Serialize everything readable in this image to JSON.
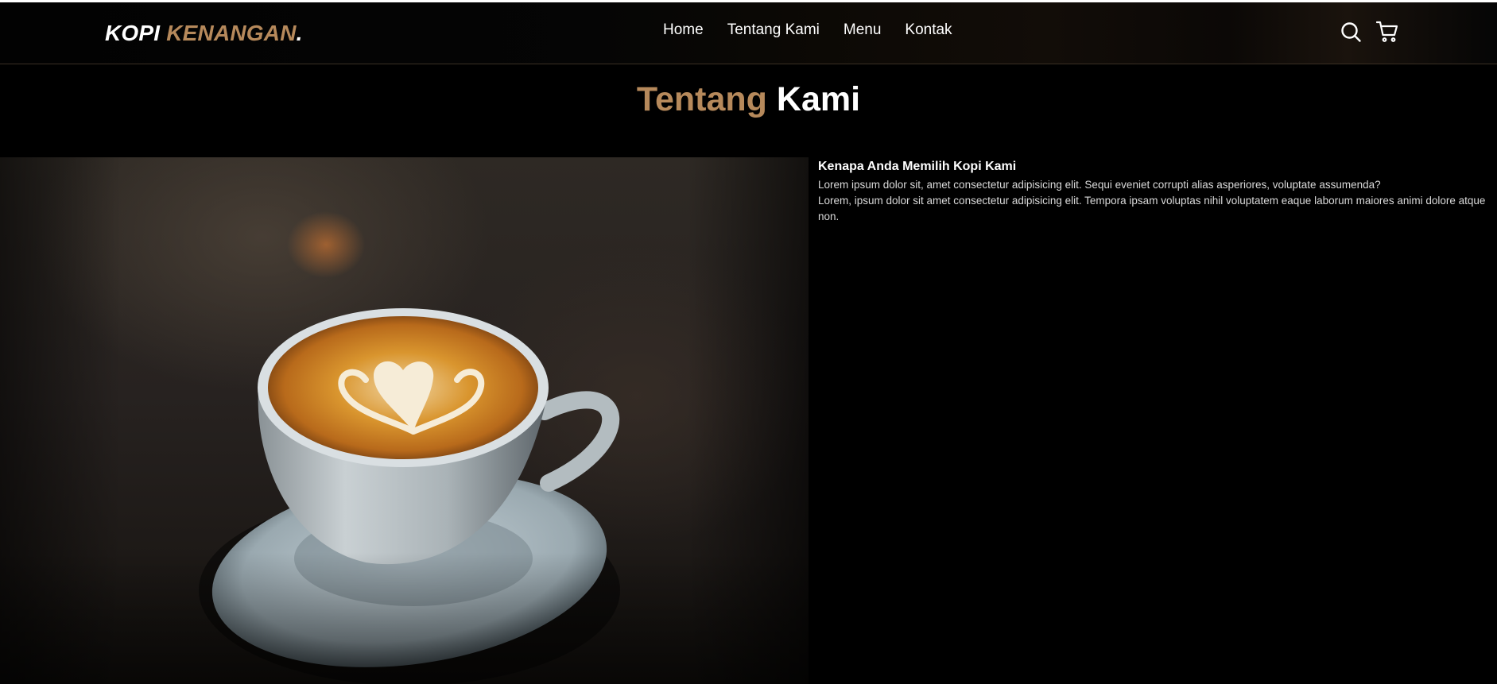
{
  "brand": {
    "name_part1": "KOPI",
    "name_part2": "KENANGAN",
    "dot": "."
  },
  "nav": {
    "links": [
      "Home",
      "Tentang Kami",
      "Menu",
      "Kontak"
    ],
    "icons": [
      "search-icon",
      "cart-icon"
    ]
  },
  "about": {
    "title_accent": "Tentang",
    "title_rest": "Kami",
    "image_alt": "coffee-cup-latte-art",
    "heading": "Kenapa Anda Memilih Kopi Kami",
    "paragraphs": [
      "Lorem ipsum dolor sit, amet consectetur adipisicing elit. Sequi eveniet corrupti alias asperiores, voluptate assumenda?",
      "Lorem, ipsum dolor sit amet consectetur adipisicing elit. Tempora ipsam voluptas nihil voluptatem eaque laborum maiores animi dolore atque non."
    ]
  },
  "colors": {
    "accent": "#b6895b",
    "background": "#000000",
    "text": "#ffffff"
  }
}
